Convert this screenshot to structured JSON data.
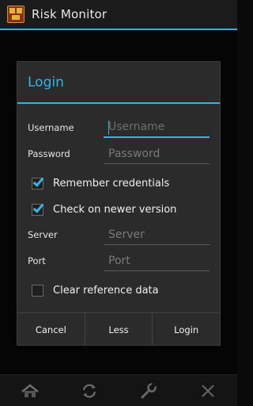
{
  "app": {
    "title": "Risk Monitor"
  },
  "dialog": {
    "title": "Login",
    "fields": {
      "username": {
        "label": "Username",
        "placeholder": "Username",
        "value": ""
      },
      "password": {
        "label": "Password",
        "placeholder": "Password",
        "value": ""
      },
      "server": {
        "label": "Server",
        "placeholder": "Server",
        "value": ""
      },
      "port": {
        "label": "Port",
        "placeholder": "Port",
        "value": ""
      }
    },
    "checkboxes": {
      "remember": {
        "label": "Remember credentials",
        "checked": true
      },
      "check_newer": {
        "label": "Check on newer version",
        "checked": true
      },
      "clear_ref": {
        "label": "Clear reference data",
        "checked": false
      }
    },
    "buttons": {
      "cancel": "Cancel",
      "less": "Less",
      "login": "Login"
    }
  },
  "bottom_bar": {
    "icons": [
      "home-icon",
      "refresh-icon",
      "wrench-icon",
      "close-icon"
    ]
  },
  "colors": {
    "accent": "#33b5e5",
    "dialog_bg": "#2b2b2b",
    "app_bg": "#0a0a0a"
  }
}
